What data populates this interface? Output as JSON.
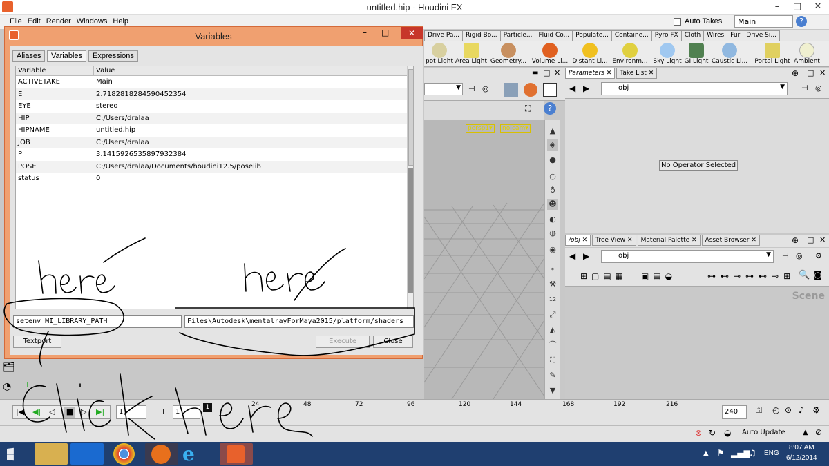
{
  "window": {
    "title": "untitled.hip - Houdini FX"
  },
  "menu": [
    "File",
    "Edit",
    "Render",
    "Windows",
    "Help"
  ],
  "header_right": {
    "auto_takes": "Auto Takes",
    "desktop": "Main"
  },
  "shelf_tabs": [
    "Drive Pa...",
    "Rigid Bo...",
    "Particle...",
    "Fluid Co...",
    "Populate...",
    "Containe...",
    "Pyro FX",
    "Cloth",
    "Wires",
    "Fur",
    "Drive Si..."
  ],
  "shelf_tools": [
    "pot Light",
    "Area Light",
    "Geometry...",
    "Volume Li...",
    "Distant Li...",
    "Environm...",
    "Sky Light",
    "GI Light",
    "Caustic Li...",
    "Portal Light",
    "Ambient"
  ],
  "viewport": {
    "persp": "persp1▾",
    "cam": "no cam▾"
  },
  "params": {
    "tabs": [
      "Parameters",
      "Take List"
    ],
    "path": "obj",
    "message": "No Operator Selected"
  },
  "network": {
    "tabs": [
      "/obj",
      "Tree View",
      "Material Palette",
      "Asset Browser"
    ],
    "path": "obj",
    "label": "Scene"
  },
  "timeline": {
    "start_field": "1",
    "current_field": "1",
    "frame_marker": "1",
    "end_field": "240",
    "ticks": [
      "24",
      "48",
      "72",
      "96",
      "120",
      "144",
      "168",
      "192",
      "216"
    ]
  },
  "status": {
    "auto_update": "Auto Update"
  },
  "taskbar": {
    "lang": "ENG",
    "time": "8:07 AM",
    "date": "6/12/2014"
  },
  "dialog": {
    "title": "Variables",
    "tabs": [
      "Aliases",
      "Variables",
      "Expressions"
    ],
    "columns": [
      "Variable",
      "Value"
    ],
    "rows": [
      {
        "name": "ACTIVETAKE",
        "value": "Main"
      },
      {
        "name": "E",
        "value": "2.7182818284590452354"
      },
      {
        "name": "EYE",
        "value": "stereo"
      },
      {
        "name": "HIP",
        "value": "C:/Users/dralaa"
      },
      {
        "name": "HIPNAME",
        "value": "untitled.hip"
      },
      {
        "name": "JOB",
        "value": "C:/Users/dralaa"
      },
      {
        "name": "PI",
        "value": "3.1415926535897932384"
      },
      {
        "name": "POSE",
        "value": "C:/Users/dralaa/Documents/houdini12.5/poselib"
      },
      {
        "name": "status",
        "value": "0"
      }
    ],
    "command_field": "setenv MI_LIBRARY_PATH",
    "value_field": "Files\\Autodesk\\mentalrayForMaya2015/platform/shaders",
    "textport": "Textport",
    "execute": "Execute",
    "close": "Close"
  },
  "annotations": {
    "left": "here",
    "right": "here",
    "bottom": "click here"
  }
}
